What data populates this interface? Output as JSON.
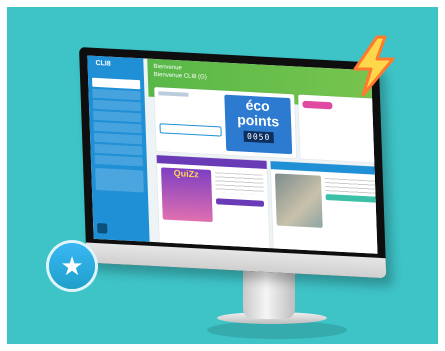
{
  "app": {
    "logo_text": "CLI8"
  },
  "banner": {
    "greeting_line1": "Bienvenue",
    "greeting_line2": "Bienvenue CLI8 (G)"
  },
  "eco_points": {
    "title_line1": "éco",
    "title_line2": "points",
    "counter_digits": "0050"
  },
  "quiz": {
    "label": "QuiZz"
  },
  "decor": {
    "lightning_icon": "lightning-bolt-icon",
    "star_icon": "star-icon"
  },
  "colors": {
    "background": "#3ec3c7",
    "sidebar": "#1f8fd6",
    "banner": "#58b847",
    "quiz_header": "#6a3bb6",
    "badge_pink": "#e04aa0"
  }
}
